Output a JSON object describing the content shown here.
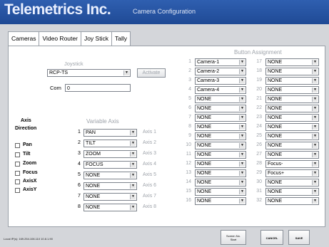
{
  "header": {
    "brand": "Telemetrics Inc.",
    "title": "Camera Configuration"
  },
  "tabs": [
    "Cameras",
    "Video Router",
    "Joy Stick",
    "Tally"
  ],
  "joystick": {
    "heading": "Joystick",
    "device": "RCP-TS",
    "activate_label": "Activate",
    "com_label": "Com",
    "com_value": "0"
  },
  "axis_direction": {
    "heading_1": "Axis",
    "heading_2": "Direction",
    "items": [
      "Pan",
      "Tilt",
      "Zoom",
      "Focus",
      "AxisX",
      "AxisY"
    ]
  },
  "variable_axis": {
    "heading": "Variable Axis",
    "rows": [
      {
        "num": "1",
        "value": "PAN",
        "label": "Axis 1"
      },
      {
        "num": "2",
        "value": "TILT",
        "label": "Axis 2"
      },
      {
        "num": "3",
        "value": "ZOOM",
        "label": "Axis 3"
      },
      {
        "num": "4",
        "value": "FOCUS",
        "label": "Axis 4"
      },
      {
        "num": "5",
        "value": "NONE",
        "label": "Axis 5"
      },
      {
        "num": "6",
        "value": "NONE",
        "label": "Axis 6"
      },
      {
        "num": "7",
        "value": "NONE",
        "label": "Axis 7"
      },
      {
        "num": "8",
        "value": "NONE",
        "label": "Axis 8"
      }
    ]
  },
  "button_assignment": {
    "heading": "Button Assignment",
    "left": [
      {
        "num": "1",
        "value": "Camera-1"
      },
      {
        "num": "2",
        "value": "Camera-2"
      },
      {
        "num": "3",
        "value": "Camera-3"
      },
      {
        "num": "4",
        "value": "Camera-4"
      },
      {
        "num": "5",
        "value": "NONE"
      },
      {
        "num": "6",
        "value": "NONE"
      },
      {
        "num": "7",
        "value": "NONE"
      },
      {
        "num": "8",
        "value": "NONE"
      },
      {
        "num": "9",
        "value": "NONE"
      },
      {
        "num": "10",
        "value": "NONE"
      },
      {
        "num": "11",
        "value": "NONE"
      },
      {
        "num": "12",
        "value": "NONE"
      },
      {
        "num": "13",
        "value": "NONE"
      },
      {
        "num": "14",
        "value": "NONE"
      },
      {
        "num": "15",
        "value": "NONE"
      },
      {
        "num": "16",
        "value": "NONE"
      }
    ],
    "right": [
      {
        "num": "17",
        "value": "NONE"
      },
      {
        "num": "18",
        "value": "NONE"
      },
      {
        "num": "19",
        "value": "NONE"
      },
      {
        "num": "20",
        "value": "NONE"
      },
      {
        "num": "21",
        "value": "NONE"
      },
      {
        "num": "22",
        "value": "NONE"
      },
      {
        "num": "23",
        "value": "NONE"
      },
      {
        "num": "24",
        "value": "NONE"
      },
      {
        "num": "25",
        "value": "NONE"
      },
      {
        "num": "26",
        "value": "NONE"
      },
      {
        "num": "27",
        "value": "NONE"
      },
      {
        "num": "28",
        "value": "Focus-"
      },
      {
        "num": "29",
        "value": "Focus+"
      },
      {
        "num": "30",
        "value": "NONE"
      },
      {
        "num": "31",
        "value": "NONE"
      },
      {
        "num": "32",
        "value": "NONE"
      }
    ]
  },
  "footer": {
    "status": "Local IP(s): 169.254.106.110 10.8.1.90",
    "screen_btn_1": "Screen No.",
    "screen_btn_2": "Start",
    "cancel_label": "CANCEL",
    "save_label": "SAVE"
  },
  "colors": {
    "header_bg": "#1f4a95",
    "panel_bg": "#ffffff",
    "window_bg": "#d4d6da"
  }
}
